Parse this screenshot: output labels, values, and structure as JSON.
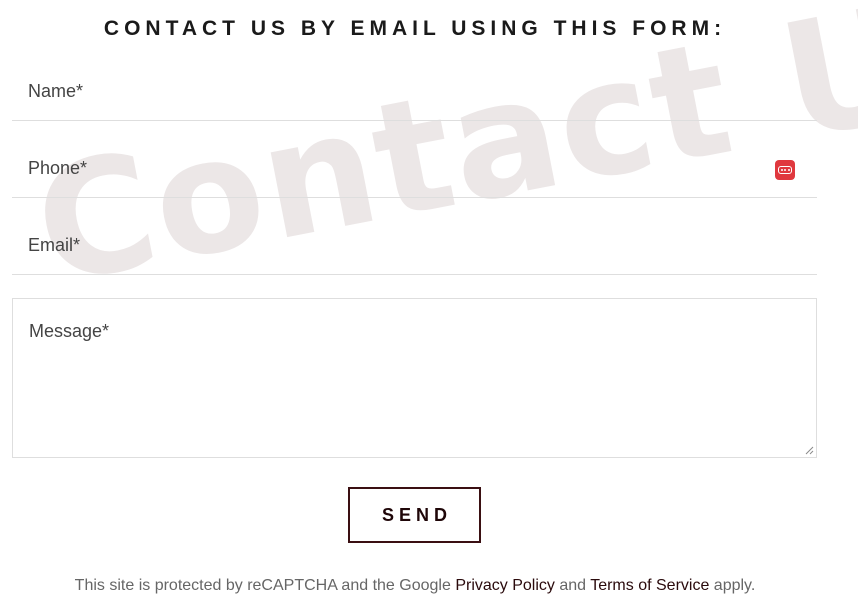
{
  "watermark": {
    "text": "Contact Us"
  },
  "form": {
    "heading": "CONTACT US BY EMAIL USING THIS FORM:",
    "fields": {
      "name": {
        "label": "Name*"
      },
      "phone": {
        "label": "Phone*"
      },
      "email": {
        "label": "Email*"
      },
      "message": {
        "label": "Message*"
      }
    },
    "send_label": "SEND"
  },
  "recaptcha": {
    "prefix": "This site is protected by reCAPTCHA and the Google",
    "privacy_link": "Privacy Policy",
    "and": "and",
    "terms_link": "Terms of Service",
    "suffix": "apply."
  },
  "icons": {
    "autofill": "password-manager-icon",
    "resize": "resize-grip-icon"
  },
  "colors": {
    "accent": "#3a0f12",
    "autofill_badge": "#e0383e",
    "watermark": "#ece7e7"
  }
}
